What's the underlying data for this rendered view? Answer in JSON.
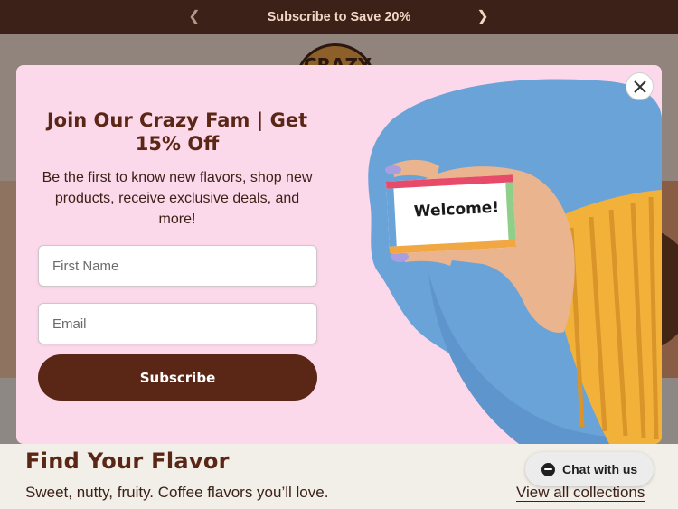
{
  "announcement": {
    "text": "Subscribe to Save 20%",
    "prev_icon": "chevron-left-icon",
    "next_icon": "chevron-right-icon"
  },
  "header": {
    "logo_text": "CRAZY"
  },
  "section": {
    "title": "Find Your Flavor",
    "subtitle": "Sweet, nutty, fruity. Coffee flavors you’ll love.",
    "view_all": "View all collections"
  },
  "popup": {
    "title": "Join Our Crazy Fam | Get 15% Off",
    "description": "Be the first to know new flavors, shop new products, receive exclusive deals, and more!",
    "first_name_placeholder": "First Name",
    "email_placeholder": "Email",
    "subscribe_label": "Subscribe",
    "image_card_text": "Welcome!",
    "close_icon": "close-icon"
  },
  "chat": {
    "label": "Chat with us",
    "icon": "chat-bubble-icon"
  },
  "colors": {
    "announcement_bg": "#3b2117",
    "popup_bg": "#fbd9ea",
    "brand_brown": "#5a2716",
    "blob_blue": "#6aa3d8",
    "sweater_yellow": "#f2b23a"
  }
}
